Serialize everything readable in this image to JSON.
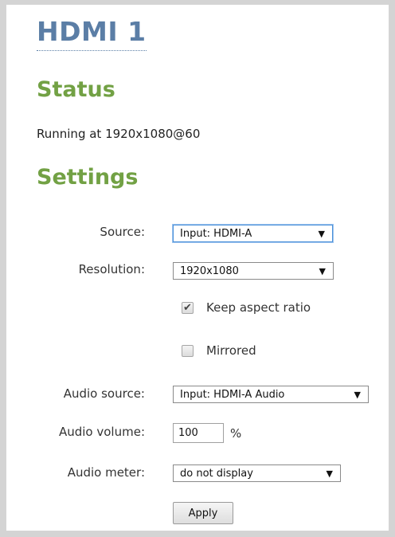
{
  "page": {
    "title": "HDMI 1"
  },
  "status": {
    "heading": "Status",
    "text": "Running at 1920x1080@60"
  },
  "settings": {
    "heading": "Settings",
    "source": {
      "label": "Source:",
      "value": "Input: HDMI-A"
    },
    "resolution": {
      "label": "Resolution:",
      "value": "1920x1080"
    },
    "keep_aspect_ratio": {
      "label": "Keep aspect ratio",
      "checked": true
    },
    "mirrored": {
      "label": "Mirrored",
      "checked": false
    },
    "audio_source": {
      "label": "Audio source:",
      "value": "Input: HDMI-A Audio"
    },
    "audio_volume": {
      "label": "Audio volume:",
      "value": "100",
      "unit": "%"
    },
    "audio_meter": {
      "label": "Audio meter:",
      "value": "do not display"
    },
    "apply_label": "Apply"
  },
  "icons": {
    "dropdown": "triangle-down-icon",
    "check": "checkmark-icon"
  },
  "colors": {
    "title": "#5b7ea6",
    "heading": "#72a144",
    "focus": "#4a90d9"
  }
}
